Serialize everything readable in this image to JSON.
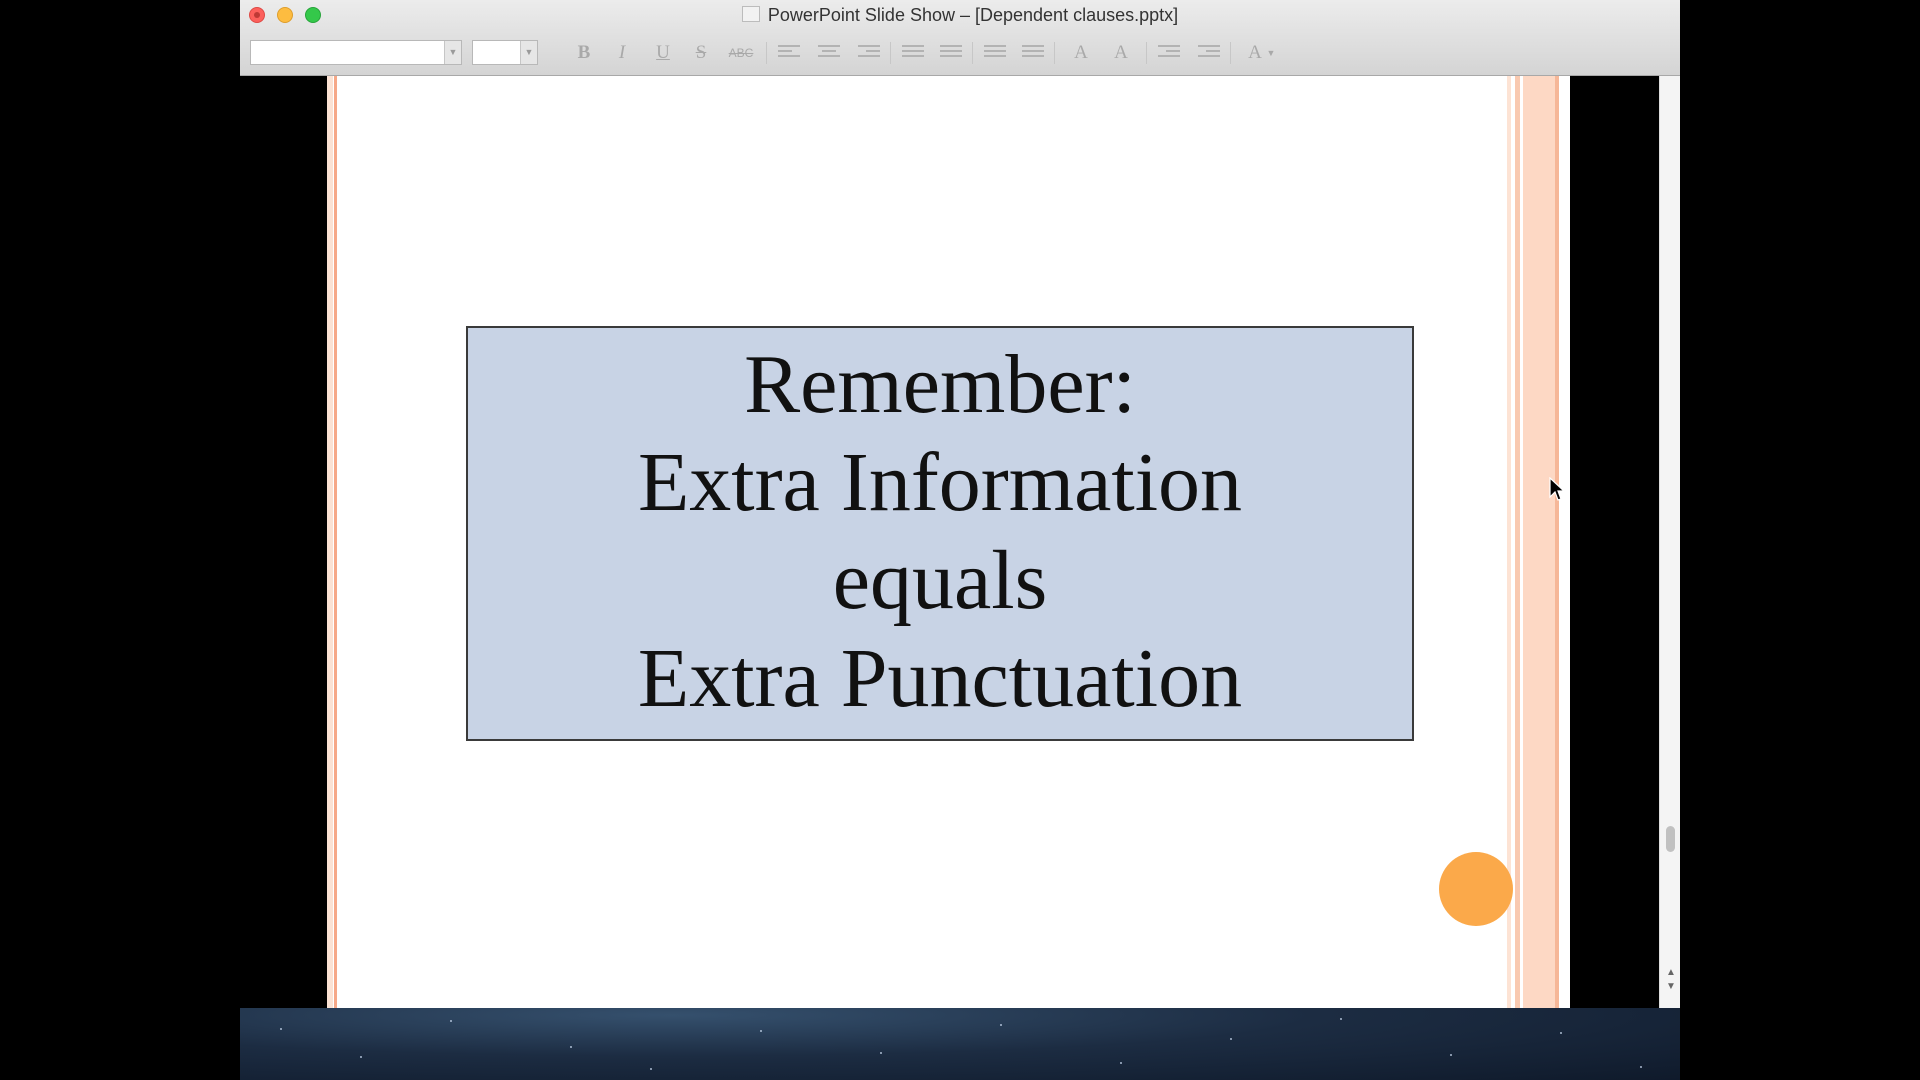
{
  "window": {
    "title": "PowerPoint Slide Show – [Dependent clauses.pptx]"
  },
  "toolbar": {
    "font_name_value": "",
    "font_size_value": "",
    "buttons": {
      "bold": "B",
      "italic": "I",
      "underline": "U",
      "strikethrough": "S",
      "small_caps": "ABC",
      "grow_font": "A",
      "shrink_font": "A",
      "font_color": "A"
    }
  },
  "slide": {
    "lines": [
      "Remember:",
      "Extra Information",
      "equals",
      "Extra Punctuation"
    ],
    "box_color": "#c8d3e5",
    "accent_color": "#fba94a",
    "stripe_color": "#f9c9b0"
  }
}
